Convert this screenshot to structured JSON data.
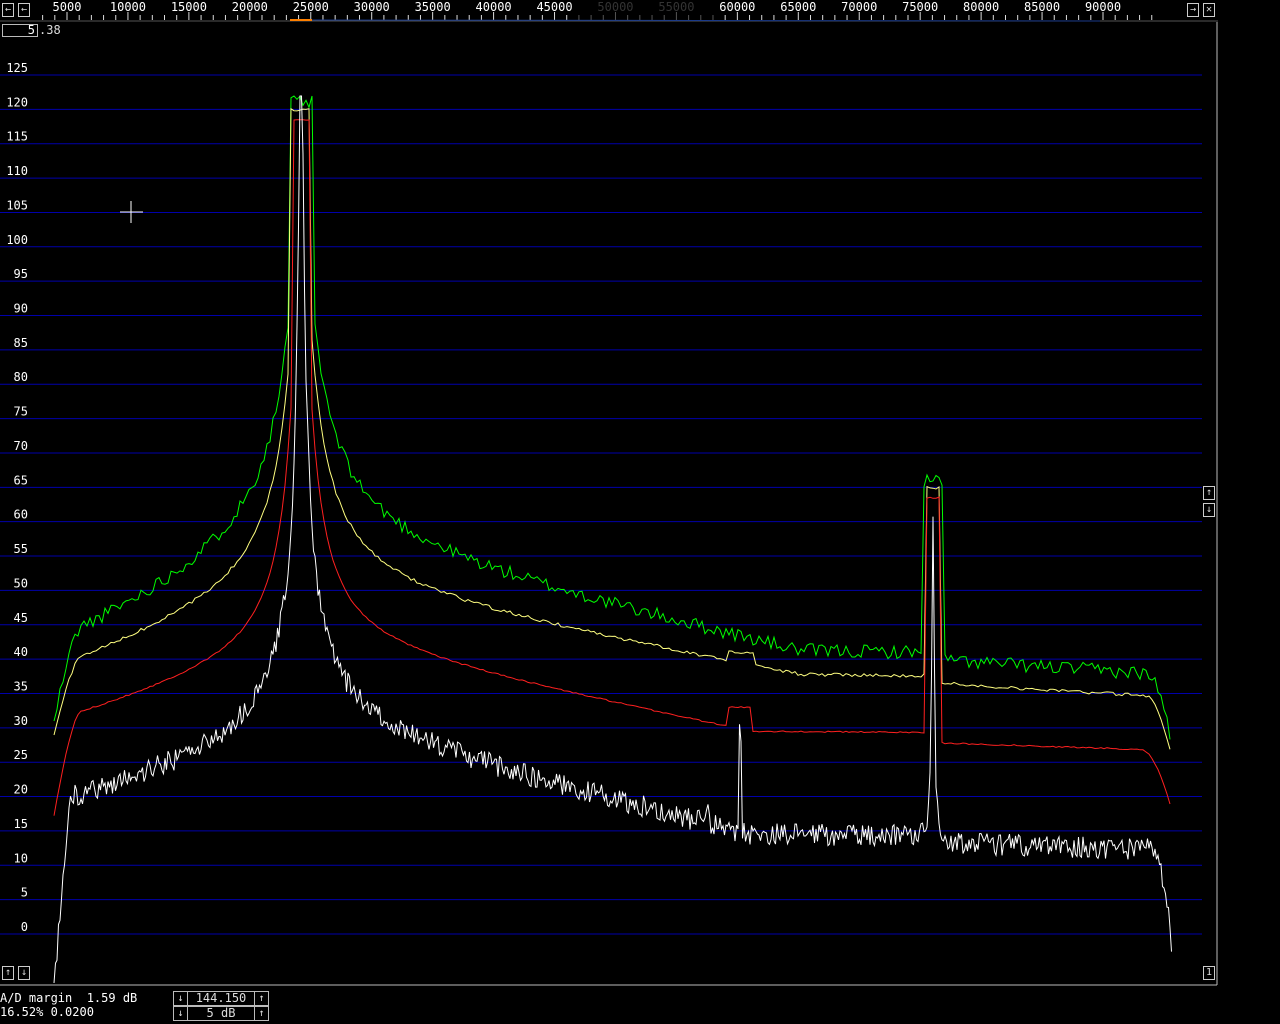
{
  "freq_axis": {
    "labels_left": [
      "5000",
      "10000",
      "15000",
      "20000",
      "25000",
      "30000",
      "35000",
      "40000",
      "45000"
    ],
    "labels_right": [
      "60000",
      "65000",
      "70000",
      "75000",
      "80000",
      "85000",
      "90000"
    ],
    "labels_faded": [
      "50000",
      "55000"
    ]
  },
  "zoom": {
    "value": "5",
    "fraction": ".38"
  },
  "db_axis": {
    "ticks": [
      "125",
      "120",
      "115",
      "110",
      "105",
      "100",
      "95",
      "90",
      "85",
      "80",
      "75",
      "70",
      "65",
      "60",
      "55",
      "50",
      "45",
      "40",
      "35",
      "30",
      "25",
      "20",
      "15",
      "10",
      "5",
      "0"
    ]
  },
  "buttons": {
    "scroll_left": "←",
    "scroll_right": "→",
    "close": "✕",
    "gain_up": "↑",
    "gain_down": "↓",
    "bottom_up": "↑",
    "bottom_down": "↓",
    "page": "1"
  },
  "status": {
    "line1": "A/D margin  1.59 dB",
    "line2": "16.52% 0.0200"
  },
  "controls": {
    "reference_value": "144.150",
    "db_per_div": "5 dB"
  },
  "colors": {
    "grid": "#0000aa",
    "green_trace": "#00ff00",
    "yellow_trace": "#ffff80",
    "red_trace": "#ff2020",
    "white_trace": "#ffffff"
  }
}
